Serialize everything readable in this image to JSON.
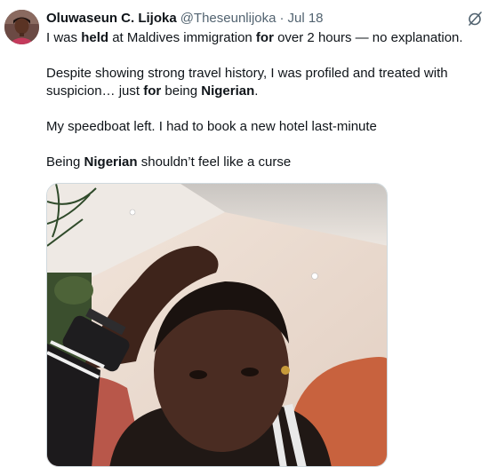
{
  "tweet": {
    "author_name": "Oluwaseun C. Lijoka",
    "handle": "@Theseunlijoka",
    "separator": "·",
    "date": "Jul 18",
    "grok_icon": "grok-icon",
    "paragraphs": [
      [
        {
          "text": "I was ",
          "bold": false
        },
        {
          "text": "held",
          "bold": true
        },
        {
          "text": " at Maldives immigration ",
          "bold": false
        },
        {
          "text": "for",
          "bold": true
        },
        {
          "text": " over 2 hours — no explanation.",
          "bold": false
        }
      ],
      [
        {
          "text": "Despite showing strong travel history, I was profiled and treated with suspicion… just ",
          "bold": false
        },
        {
          "text": "for",
          "bold": true
        },
        {
          "text": " being ",
          "bold": false
        },
        {
          "text": "Nigerian",
          "bold": true
        },
        {
          "text": ".",
          "bold": false
        }
      ],
      [
        {
          "text": "My speedboat left. I had to book a new hotel last-minute",
          "bold": false
        }
      ],
      [
        {
          "text": "Being ",
          "bold": false
        },
        {
          "text": "Nigerian",
          "bold": true
        },
        {
          "text": " shouldn’t feel like a curse",
          "bold": false
        }
      ]
    ],
    "media_type": "photo"
  }
}
